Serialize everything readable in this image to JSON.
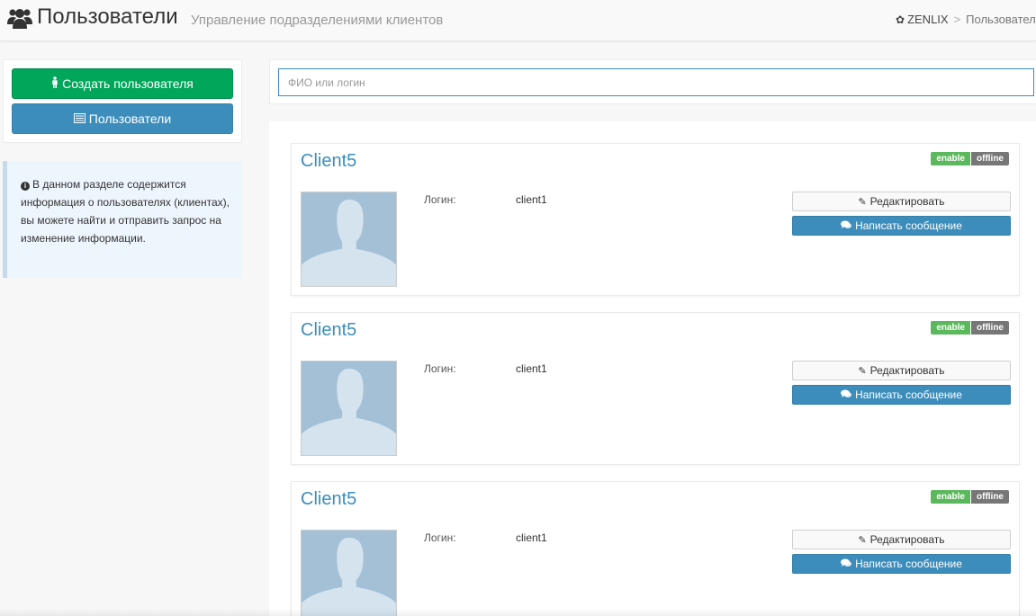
{
  "header": {
    "title": "Пользователи",
    "subtitle": "Управление подразделениями клиентов",
    "breadcrumb": {
      "home": "ZENLIX",
      "separator": ">",
      "current": "Пользователи"
    }
  },
  "sidebar": {
    "create_button": "Создать пользователя",
    "users_button": "Пользователи",
    "info_text": "В данном разделе содержится информация о пользователях (клиентах), вы можете найти и отправить запрос на изменение информации."
  },
  "search": {
    "placeholder": "ФИО или логин",
    "value": ""
  },
  "users": [
    {
      "name": "Client5",
      "login_label": "Логин:",
      "login": "client1",
      "status": "enable",
      "presence": "offline",
      "edit_label": "Редактировать",
      "message_label": "Написать сообщение"
    },
    {
      "name": "Client5",
      "login_label": "Логин:",
      "login": "client1",
      "status": "enable",
      "presence": "offline",
      "edit_label": "Редактировать",
      "message_label": "Написать сообщение"
    },
    {
      "name": "Client5",
      "login_label": "Логин:",
      "login": "client1",
      "status": "enable",
      "presence": "offline",
      "edit_label": "Редактировать",
      "message_label": "Написать сообщение"
    }
  ],
  "icons": {
    "header": "users-icon",
    "breadcrumb": "gear-icon",
    "create": "male-icon",
    "list": "list-icon",
    "info": "info-circle-icon",
    "edit": "pencil-icon",
    "message": "comments-icon"
  },
  "colors": {
    "primary": "#3c8dbc",
    "success": "#00a65a",
    "enable_badge": "#5cb85c",
    "offline_badge": "#777777",
    "info_bg": "#eef6fd"
  }
}
